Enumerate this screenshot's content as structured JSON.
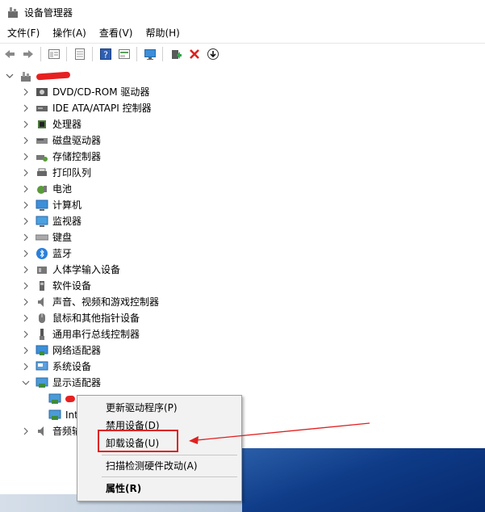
{
  "window": {
    "title": "设备管理器"
  },
  "menu": [
    "文件(F)",
    "操作(A)",
    "查看(V)",
    "帮助(H)"
  ],
  "toolbar": {
    "buttons": [
      "back-icon",
      "forward-icon",
      "properties-icon",
      "list-icon",
      "help-icon",
      "view-icon",
      "monitor-icon",
      "update-driver-icon",
      "uninstall-icon",
      "download-icon"
    ]
  },
  "tree": {
    "categories": [
      "DVD/CD-ROM 驱动器",
      "IDE ATA/ATAPI 控制器",
      "处理器",
      "磁盘驱动器",
      "存储控制器",
      "打印队列",
      "电池",
      "计算机",
      "监视器",
      "键盘",
      "蓝牙",
      "人体学输入设备",
      "软件设备",
      "声音、视频和游戏控制器",
      "鼠标和其他指针设备",
      "通用串行总线控制器",
      "网络适配器",
      "系统设备",
      "显示适配器"
    ],
    "display_children": [
      "Int"
    ],
    "partial_last": "音频输"
  },
  "context_menu": {
    "items": [
      "更新驱动程序(P)",
      "禁用设备(D)",
      "卸载设备(U)",
      "扫描检测硬件改动(A)",
      "属性(R)"
    ]
  },
  "colors": {
    "highlight": "#e02020",
    "arrow": "#e02020"
  }
}
